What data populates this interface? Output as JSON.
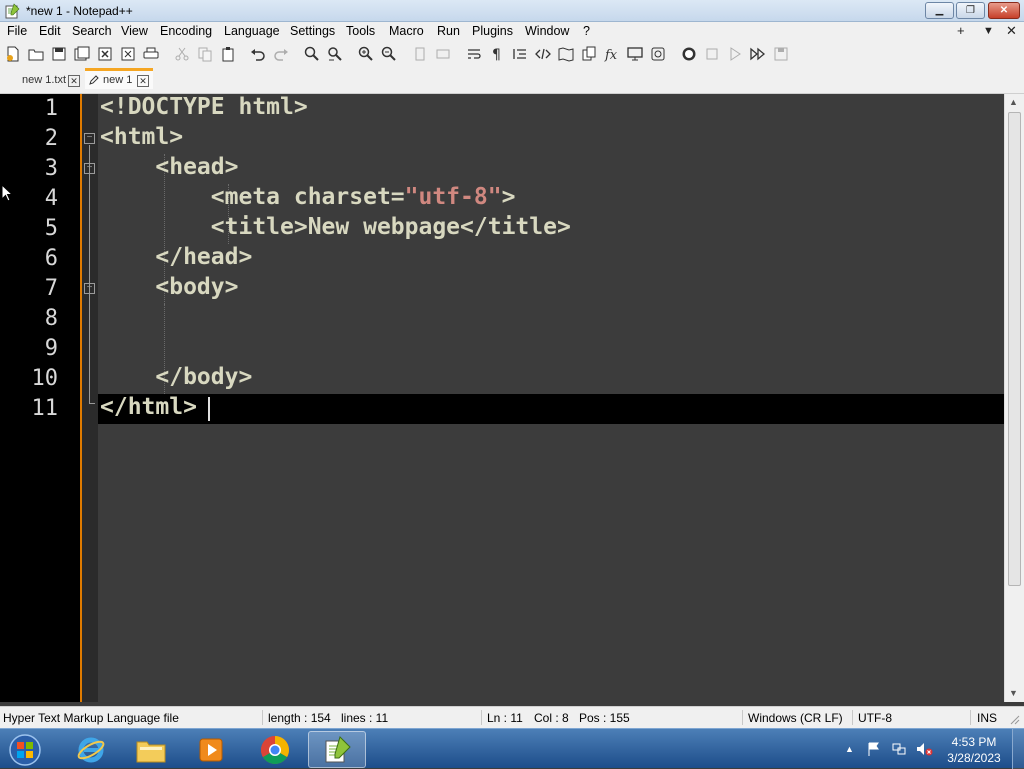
{
  "window": {
    "title": "*new 1 - Notepad++"
  },
  "menu": {
    "items": [
      "File",
      "Edit",
      "Search",
      "View",
      "Encoding",
      "Language",
      "Settings",
      "Tools",
      "Macro",
      "Run",
      "Plugins",
      "Window",
      "?"
    ],
    "right": [
      "+",
      "▼",
      "✕"
    ]
  },
  "tabs": [
    {
      "label": "new 1.txt",
      "active": false,
      "close": "✕"
    },
    {
      "label": "new 1",
      "active": true,
      "close": "✕"
    }
  ],
  "editor": {
    "line_numbers": [
      "1",
      "2",
      "3",
      "4",
      "5",
      "6",
      "7",
      "8",
      "9",
      "10",
      "11"
    ],
    "lines": [
      {
        "text": "<!DOCTYPE html>"
      },
      {
        "text": "<html>"
      },
      {
        "text": "    <head>"
      },
      {
        "pre": "        <meta charset=",
        "str": "\"utf-8\"",
        "post": ">"
      },
      {
        "text": "        <title>New webpage</title>"
      },
      {
        "text": "    </head>"
      },
      {
        "text": "    <body>"
      },
      {
        "text": ""
      },
      {
        "text": ""
      },
      {
        "text": "    </body>"
      },
      {
        "text": "</html>"
      }
    ],
    "current_line": 11
  },
  "status": {
    "file_type": "Hyper Text Markup Language file",
    "length": "length : 154",
    "lines": "lines : 11",
    "ln": "Ln : 11",
    "col": "Col : 8",
    "pos": "Pos : 155",
    "eol": "Windows (CR LF)",
    "encoding": "UTF-8",
    "mode": "INS"
  },
  "taskbar": {
    "clock_time": "4:53 PM",
    "clock_date": "3/28/2023",
    "tray_chevron": "▲"
  },
  "colors": {
    "editor_bg": "#3c3c3c",
    "gutter_bg": "#000000",
    "text": "#d8d8c0",
    "string": "#d08880",
    "current_line": "#000000",
    "fold_margin_accent": "#e07b00"
  }
}
